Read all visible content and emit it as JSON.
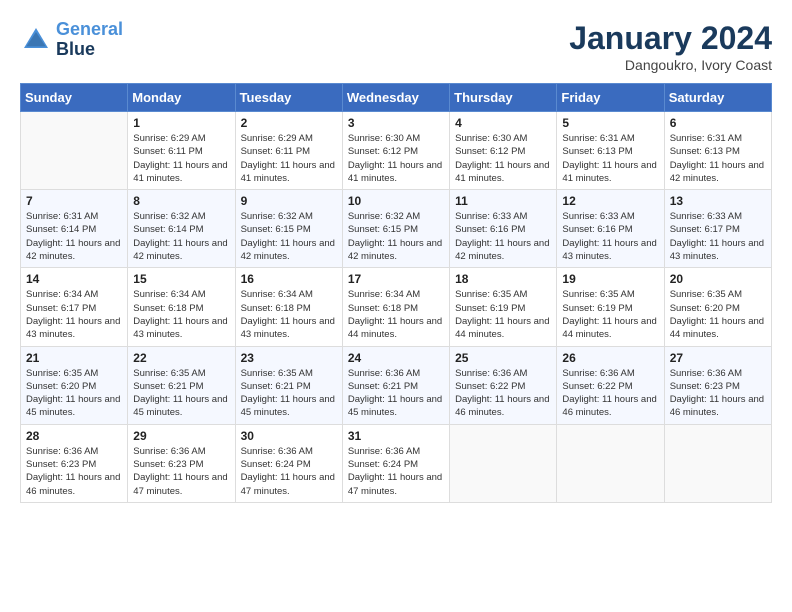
{
  "header": {
    "logo_line1": "General",
    "logo_line2": "Blue",
    "month": "January 2024",
    "location": "Dangoukro, Ivory Coast"
  },
  "days_of_week": [
    "Sunday",
    "Monday",
    "Tuesday",
    "Wednesday",
    "Thursday",
    "Friday",
    "Saturday"
  ],
  "weeks": [
    [
      {
        "day": "",
        "sunrise": "",
        "sunset": "",
        "daylight": ""
      },
      {
        "day": "1",
        "sunrise": "Sunrise: 6:29 AM",
        "sunset": "Sunset: 6:11 PM",
        "daylight": "Daylight: 11 hours and 41 minutes."
      },
      {
        "day": "2",
        "sunrise": "Sunrise: 6:29 AM",
        "sunset": "Sunset: 6:11 PM",
        "daylight": "Daylight: 11 hours and 41 minutes."
      },
      {
        "day": "3",
        "sunrise": "Sunrise: 6:30 AM",
        "sunset": "Sunset: 6:12 PM",
        "daylight": "Daylight: 11 hours and 41 minutes."
      },
      {
        "day": "4",
        "sunrise": "Sunrise: 6:30 AM",
        "sunset": "Sunset: 6:12 PM",
        "daylight": "Daylight: 11 hours and 41 minutes."
      },
      {
        "day": "5",
        "sunrise": "Sunrise: 6:31 AM",
        "sunset": "Sunset: 6:13 PM",
        "daylight": "Daylight: 11 hours and 41 minutes."
      },
      {
        "day": "6",
        "sunrise": "Sunrise: 6:31 AM",
        "sunset": "Sunset: 6:13 PM",
        "daylight": "Daylight: 11 hours and 42 minutes."
      }
    ],
    [
      {
        "day": "7",
        "sunrise": "Sunrise: 6:31 AM",
        "sunset": "Sunset: 6:14 PM",
        "daylight": "Daylight: 11 hours and 42 minutes."
      },
      {
        "day": "8",
        "sunrise": "Sunrise: 6:32 AM",
        "sunset": "Sunset: 6:14 PM",
        "daylight": "Daylight: 11 hours and 42 minutes."
      },
      {
        "day": "9",
        "sunrise": "Sunrise: 6:32 AM",
        "sunset": "Sunset: 6:15 PM",
        "daylight": "Daylight: 11 hours and 42 minutes."
      },
      {
        "day": "10",
        "sunrise": "Sunrise: 6:32 AM",
        "sunset": "Sunset: 6:15 PM",
        "daylight": "Daylight: 11 hours and 42 minutes."
      },
      {
        "day": "11",
        "sunrise": "Sunrise: 6:33 AM",
        "sunset": "Sunset: 6:16 PM",
        "daylight": "Daylight: 11 hours and 42 minutes."
      },
      {
        "day": "12",
        "sunrise": "Sunrise: 6:33 AM",
        "sunset": "Sunset: 6:16 PM",
        "daylight": "Daylight: 11 hours and 43 minutes."
      },
      {
        "day": "13",
        "sunrise": "Sunrise: 6:33 AM",
        "sunset": "Sunset: 6:17 PM",
        "daylight": "Daylight: 11 hours and 43 minutes."
      }
    ],
    [
      {
        "day": "14",
        "sunrise": "Sunrise: 6:34 AM",
        "sunset": "Sunset: 6:17 PM",
        "daylight": "Daylight: 11 hours and 43 minutes."
      },
      {
        "day": "15",
        "sunrise": "Sunrise: 6:34 AM",
        "sunset": "Sunset: 6:18 PM",
        "daylight": "Daylight: 11 hours and 43 minutes."
      },
      {
        "day": "16",
        "sunrise": "Sunrise: 6:34 AM",
        "sunset": "Sunset: 6:18 PM",
        "daylight": "Daylight: 11 hours and 43 minutes."
      },
      {
        "day": "17",
        "sunrise": "Sunrise: 6:34 AM",
        "sunset": "Sunset: 6:18 PM",
        "daylight": "Daylight: 11 hours and 44 minutes."
      },
      {
        "day": "18",
        "sunrise": "Sunrise: 6:35 AM",
        "sunset": "Sunset: 6:19 PM",
        "daylight": "Daylight: 11 hours and 44 minutes."
      },
      {
        "day": "19",
        "sunrise": "Sunrise: 6:35 AM",
        "sunset": "Sunset: 6:19 PM",
        "daylight": "Daylight: 11 hours and 44 minutes."
      },
      {
        "day": "20",
        "sunrise": "Sunrise: 6:35 AM",
        "sunset": "Sunset: 6:20 PM",
        "daylight": "Daylight: 11 hours and 44 minutes."
      }
    ],
    [
      {
        "day": "21",
        "sunrise": "Sunrise: 6:35 AM",
        "sunset": "Sunset: 6:20 PM",
        "daylight": "Daylight: 11 hours and 45 minutes."
      },
      {
        "day": "22",
        "sunrise": "Sunrise: 6:35 AM",
        "sunset": "Sunset: 6:21 PM",
        "daylight": "Daylight: 11 hours and 45 minutes."
      },
      {
        "day": "23",
        "sunrise": "Sunrise: 6:35 AM",
        "sunset": "Sunset: 6:21 PM",
        "daylight": "Daylight: 11 hours and 45 minutes."
      },
      {
        "day": "24",
        "sunrise": "Sunrise: 6:36 AM",
        "sunset": "Sunset: 6:21 PM",
        "daylight": "Daylight: 11 hours and 45 minutes."
      },
      {
        "day": "25",
        "sunrise": "Sunrise: 6:36 AM",
        "sunset": "Sunset: 6:22 PM",
        "daylight": "Daylight: 11 hours and 46 minutes."
      },
      {
        "day": "26",
        "sunrise": "Sunrise: 6:36 AM",
        "sunset": "Sunset: 6:22 PM",
        "daylight": "Daylight: 11 hours and 46 minutes."
      },
      {
        "day": "27",
        "sunrise": "Sunrise: 6:36 AM",
        "sunset": "Sunset: 6:23 PM",
        "daylight": "Daylight: 11 hours and 46 minutes."
      }
    ],
    [
      {
        "day": "28",
        "sunrise": "Sunrise: 6:36 AM",
        "sunset": "Sunset: 6:23 PM",
        "daylight": "Daylight: 11 hours and 46 minutes."
      },
      {
        "day": "29",
        "sunrise": "Sunrise: 6:36 AM",
        "sunset": "Sunset: 6:23 PM",
        "daylight": "Daylight: 11 hours and 47 minutes."
      },
      {
        "day": "30",
        "sunrise": "Sunrise: 6:36 AM",
        "sunset": "Sunset: 6:24 PM",
        "daylight": "Daylight: 11 hours and 47 minutes."
      },
      {
        "day": "31",
        "sunrise": "Sunrise: 6:36 AM",
        "sunset": "Sunset: 6:24 PM",
        "daylight": "Daylight: 11 hours and 47 minutes."
      },
      {
        "day": "",
        "sunrise": "",
        "sunset": "",
        "daylight": ""
      },
      {
        "day": "",
        "sunrise": "",
        "sunset": "",
        "daylight": ""
      },
      {
        "day": "",
        "sunrise": "",
        "sunset": "",
        "daylight": ""
      }
    ]
  ]
}
